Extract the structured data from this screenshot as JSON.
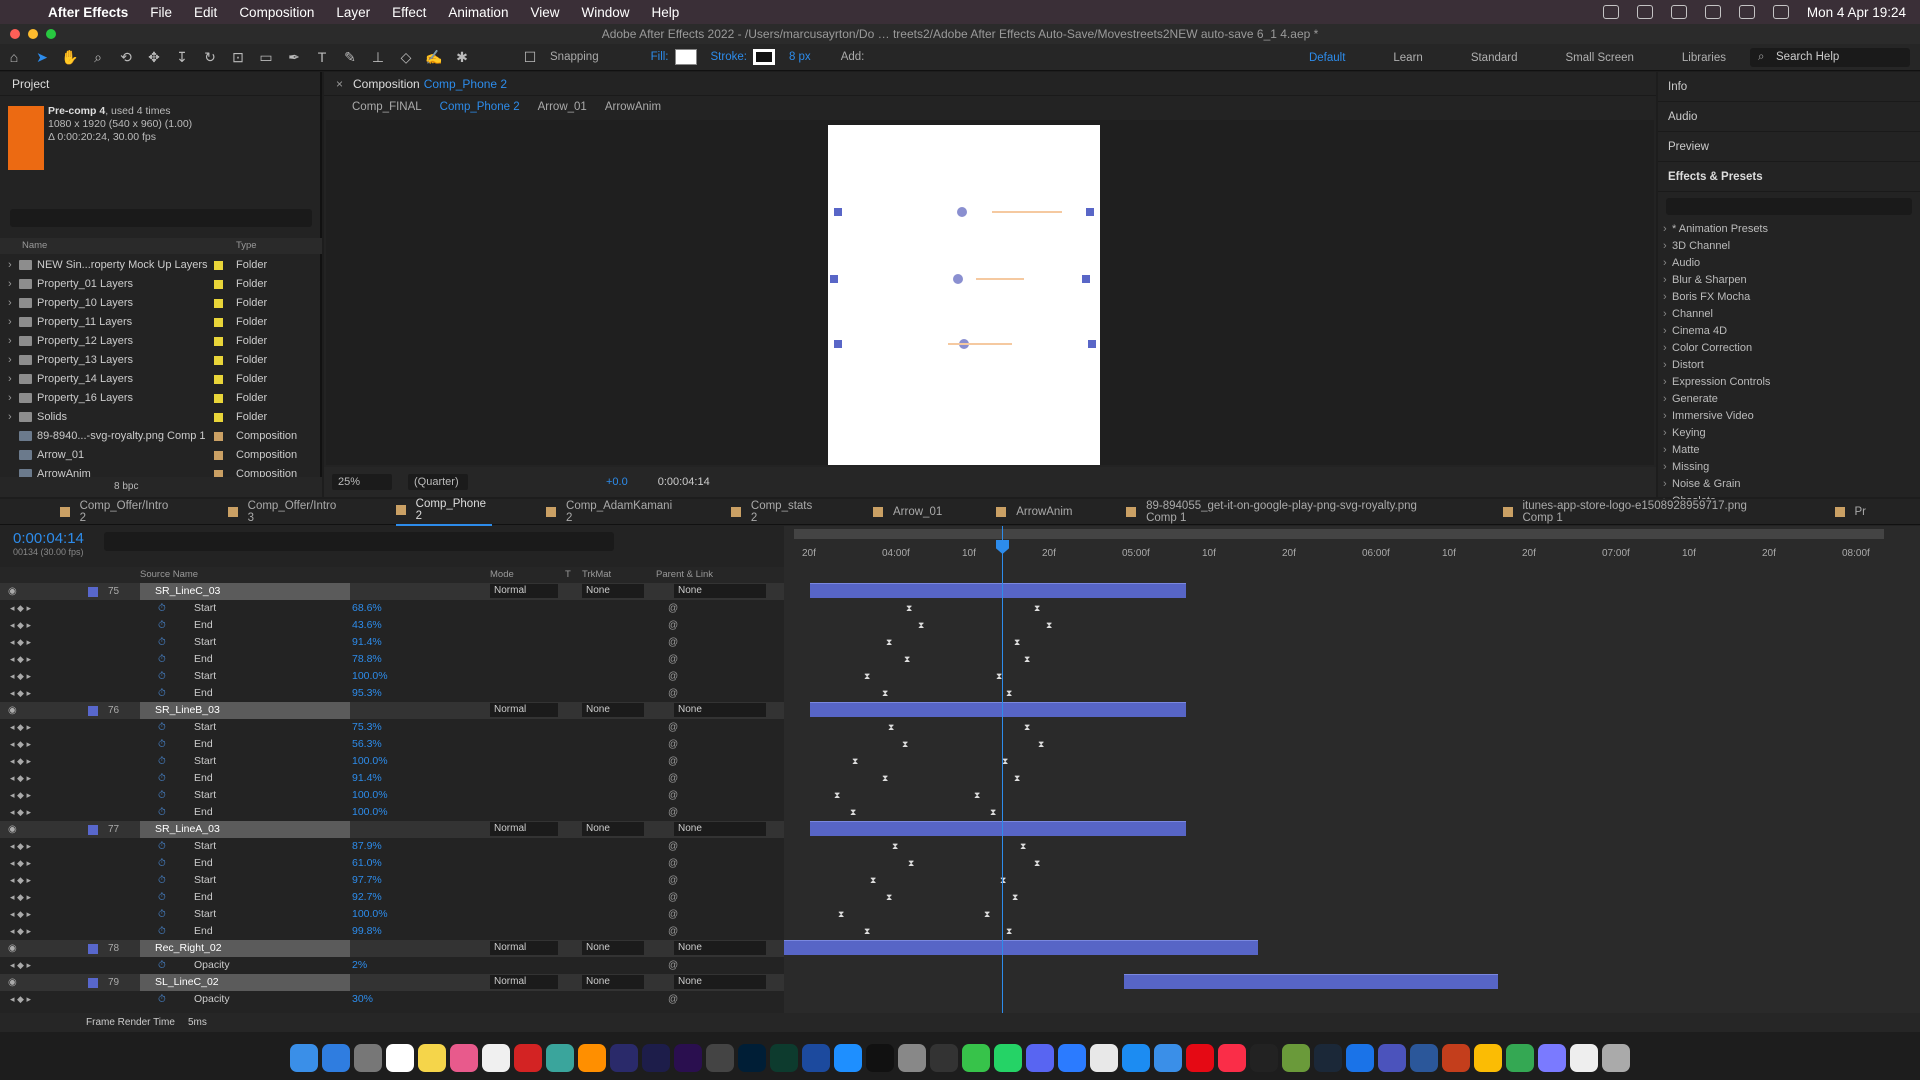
{
  "menubar": {
    "app": "After Effects",
    "items": [
      "File",
      "Edit",
      "Composition",
      "Layer",
      "Effect",
      "Animation",
      "View",
      "Window",
      "Help"
    ],
    "datetime": "Mon 4 Apr  19:24"
  },
  "title": "Adobe After Effects 2022 - /Users/marcusayrton/Do … treets2/Adobe After Effects Auto-Save/Movestreets2NEW auto-save 6_1 4.aep *",
  "toolbar": {
    "snapping": "Snapping",
    "fill": "Fill:",
    "stroke": "Stroke:",
    "stroke_px": "8 px",
    "add": "Add:",
    "workspaces": [
      "Default",
      "Learn",
      "Standard",
      "Small Screen",
      "Libraries"
    ],
    "active_workspace": "Default",
    "search": "Search Help"
  },
  "project": {
    "title": "Project",
    "item": {
      "name": "Pre-comp 4",
      "used": ", used 4 times",
      "dims": "1080 x 1920  (540 x 960) (1.00)",
      "dur": "Δ 0:00:20:24, 30.00 fps"
    },
    "cols": {
      "name": "Name",
      "type": "Type"
    },
    "rows": [
      {
        "name": "NEW Sin...roperty Mock Up Layers",
        "type": "Folder"
      },
      {
        "name": "Property_01 Layers",
        "type": "Folder"
      },
      {
        "name": "Property_10 Layers",
        "type": "Folder"
      },
      {
        "name": "Property_11 Layers",
        "type": "Folder"
      },
      {
        "name": "Property_12 Layers",
        "type": "Folder"
      },
      {
        "name": "Property_13 Layers",
        "type": "Folder"
      },
      {
        "name": "Property_14 Layers",
        "type": "Folder"
      },
      {
        "name": "Property_16 Layers",
        "type": "Folder"
      },
      {
        "name": "Solids",
        "type": "Folder"
      },
      {
        "name": "89-8940...-svg-royalty.png Comp 1",
        "type": "Composition"
      },
      {
        "name": "Arrow_01",
        "type": "Composition"
      },
      {
        "name": "ArrowAnim",
        "type": "Composition"
      }
    ],
    "bpc": "8 bpc"
  },
  "comp": {
    "label": "Composition",
    "name": "Comp_Phone 2",
    "crumbs": [
      "Comp_FINAL",
      "Comp_Phone 2",
      "Arrow_01",
      "ArrowAnim"
    ],
    "zoom": "25%",
    "quality": "(Quarter)",
    "exposure": "+0.0",
    "timecode": "0:00:04:14"
  },
  "right": {
    "panels": [
      "Info",
      "Audio",
      "Preview"
    ],
    "effects_title": "Effects & Presets",
    "effects": [
      "* Animation Presets",
      "3D Channel",
      "Audio",
      "Blur & Sharpen",
      "Boris FX Mocha",
      "Channel",
      "Cinema 4D",
      "Color Correction",
      "Distort",
      "Expression Controls",
      "Generate",
      "Immersive Video",
      "Keying",
      "Matte",
      "Missing",
      "Noise & Grain",
      "Obsolete"
    ]
  },
  "timeline": {
    "tabs": [
      "Comp_Offer/Intro 2",
      "Comp_Offer/Intro 3",
      "Comp_Phone 2",
      "Comp_AdamKamani 2",
      "Comp_stats 2",
      "Arrow_01",
      "ArrowAnim",
      "89-894055_get-it-on-google-play-png-svg-royalty.png Comp 1",
      "itunes-app-store-logo-e1508928959717.png Comp 1",
      "Pr"
    ],
    "active_tab": "Comp_Phone 2",
    "timecode": "0:00:04:14",
    "fps": "00134 (30.00 fps)",
    "headers": {
      "source": "Source Name",
      "mode": "Mode",
      "t": "T",
      "trkmat": "TrkMat",
      "parent": "Parent & Link"
    },
    "ruler": [
      "20f",
      "04:00f",
      "10f",
      "20f",
      "05:00f",
      "10f",
      "20f",
      "06:00f",
      "10f",
      "20f",
      "07:00f",
      "10f",
      "20f",
      "08:00f"
    ],
    "layers": [
      {
        "num": "75",
        "name": "SR_LineC_03",
        "mode": "Normal",
        "trk": "None",
        "parent": "None",
        "props": [
          [
            "Start",
            "68.6%"
          ],
          [
            "End",
            "43.6%"
          ],
          [
            "Start",
            "91.4%"
          ],
          [
            "End",
            "78.8%"
          ],
          [
            "Start",
            "100.0%"
          ],
          [
            "End",
            "95.3%"
          ]
        ]
      },
      {
        "num": "76",
        "name": "SR_LineB_03",
        "mode": "Normal",
        "trk": "None",
        "parent": "None",
        "props": [
          [
            "Start",
            "75.3%"
          ],
          [
            "End",
            "56.3%"
          ],
          [
            "Start",
            "100.0%"
          ],
          [
            "End",
            "91.4%"
          ],
          [
            "Start",
            "100.0%"
          ],
          [
            "End",
            "100.0%"
          ]
        ]
      },
      {
        "num": "77",
        "name": "SR_LineA_03",
        "mode": "Normal",
        "trk": "None",
        "parent": "None",
        "props": [
          [
            "Start",
            "87.9%"
          ],
          [
            "End",
            "61.0%"
          ],
          [
            "Start",
            "97.7%"
          ],
          [
            "End",
            "92.7%"
          ],
          [
            "Start",
            "100.0%"
          ],
          [
            "End",
            "99.8%"
          ]
        ]
      },
      {
        "num": "78",
        "name": "Rec_Right_02",
        "mode": "Normal",
        "trk": "None",
        "parent": "None",
        "props": [
          [
            "Opacity",
            "2%"
          ]
        ]
      },
      {
        "num": "79",
        "name": "SL_LineC_02",
        "mode": "Normal",
        "trk": "None",
        "parent": "None",
        "props": [
          [
            "Opacity",
            "30%"
          ]
        ]
      }
    ],
    "footer": "Frame Render Time",
    "render_time": "5ms"
  },
  "dock": [
    "Finder",
    "Mail",
    "Launchpad",
    "Calendar",
    "Notes",
    "Photos",
    "Reminders",
    "Creative Cloud",
    "Maya",
    "Illustrator",
    "After Effects",
    "Media Encoder",
    "Premiere",
    "Help",
    "Photoshop",
    "Painter",
    "Cinema 4D",
    "Safari",
    "Apple TV",
    "Settings",
    "Unity",
    "Messages",
    "WhatsApp",
    "Discord",
    "Messenger",
    "Photos2",
    "App Store",
    "Mail2",
    "Netflix",
    "Music",
    "Activity",
    "Minecraft",
    "Steam",
    "TeamViewer",
    "Teams",
    "Word",
    "PowerPoint",
    "Chrome",
    "Drive",
    "Siri",
    "Preview",
    "Trash"
  ]
}
